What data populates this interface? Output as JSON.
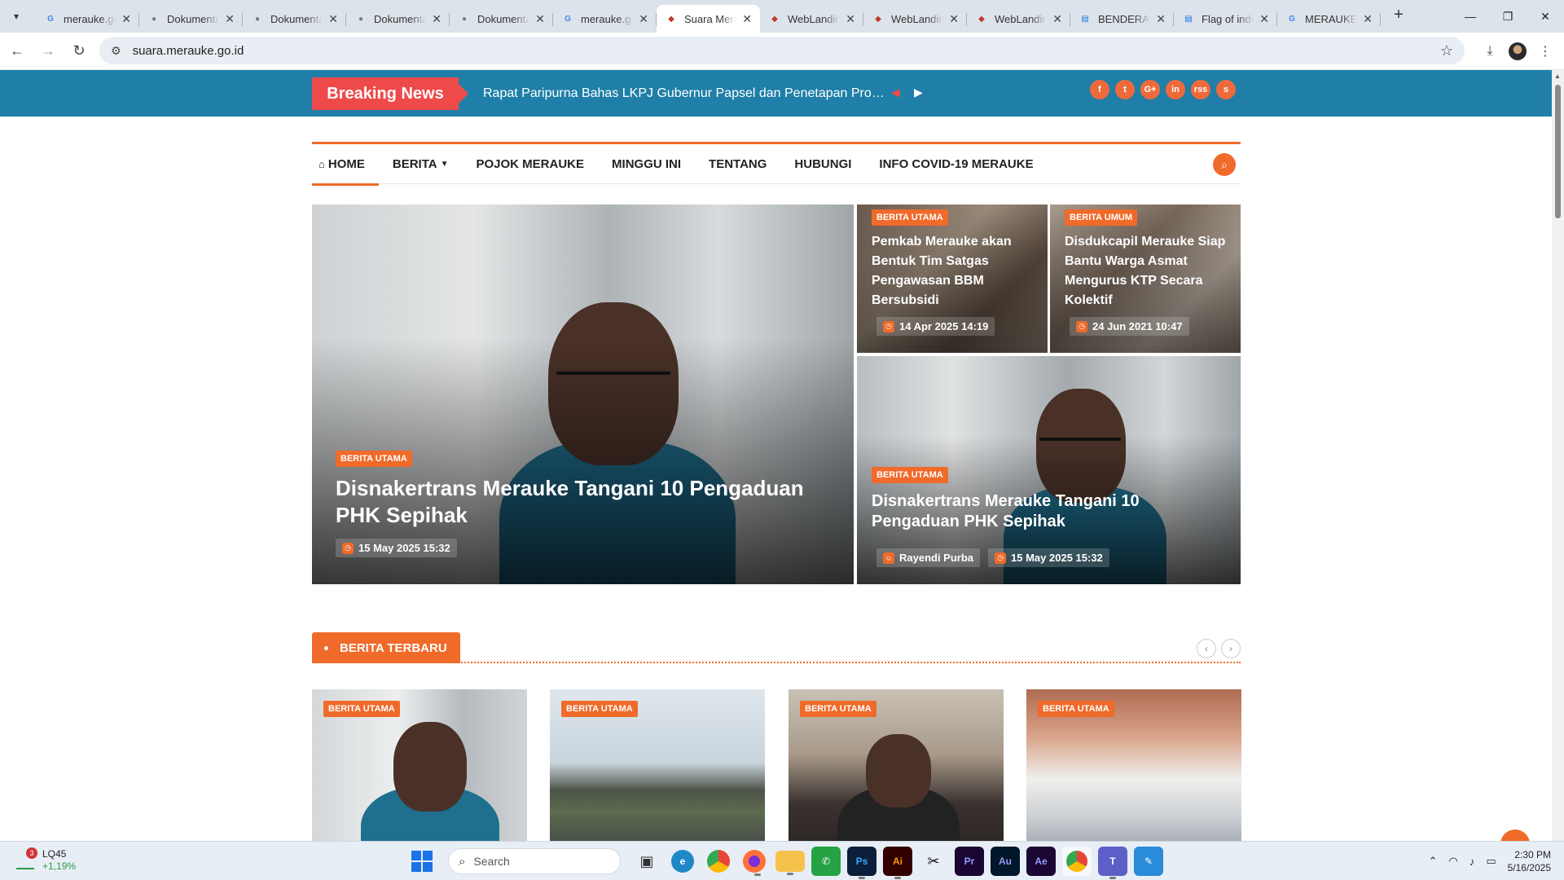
{
  "browser": {
    "tabs": [
      {
        "label": "merauke.go.id",
        "favicon": "G",
        "favicon_color": "#4285f4"
      },
      {
        "label": "Dokumentasi",
        "favicon": "●",
        "favicon_color": "#7a7a7a"
      },
      {
        "label": "Dokumentasi",
        "favicon": "●",
        "favicon_color": "#7a7a7a"
      },
      {
        "label": "Dokumentasi",
        "favicon": "●",
        "favicon_color": "#7a7a7a"
      },
      {
        "label": "Dokumentasi",
        "favicon": "●",
        "favicon_color": "#7a7a7a"
      },
      {
        "label": "merauke.go.id",
        "favicon": "G",
        "favicon_color": "#4285f4"
      },
      {
        "label": "Suara Merauke",
        "favicon": "◆",
        "favicon_color": "#c0392b",
        "active": true
      },
      {
        "label": "WebLanding",
        "favicon": "◆",
        "favicon_color": "#c0392b"
      },
      {
        "label": "WebLanding",
        "favicon": "◆",
        "favicon_color": "#c0392b"
      },
      {
        "label": "WebLanding",
        "favicon": "◆",
        "favicon_color": "#c0392b"
      },
      {
        "label": "BENDERA",
        "favicon": "▤",
        "favicon_color": "#1a73e8"
      },
      {
        "label": "Flag of indonesia",
        "favicon": "▤",
        "favicon_color": "#1a73e8"
      },
      {
        "label": "MERAUKE",
        "favicon": "G",
        "favicon_color": "#4285f4"
      }
    ],
    "url": "suara.merauke.go.id"
  },
  "site": {
    "breaking_label": "Breaking News",
    "breaking_text": "Rapat Paripurna Bahas LKPJ Gubernur Papsel dan Penetapan Propemperda",
    "socials": [
      "f",
      "t",
      "G+",
      "in",
      "rss",
      "s"
    ],
    "nav": [
      "HOME",
      "BERITA",
      "POJOK MERAUKE",
      "MINGGU INI",
      "TENTANG",
      "HUBUNGI",
      "INFO COVID-19 MERAUKE"
    ],
    "accent_color": "#f06a2a",
    "topbar_color": "#1f7fa8"
  },
  "hero": {
    "main": {
      "category": "BERITA UTAMA",
      "title": "Disnakertrans Merauke Tangani 10 Pengaduan PHK Sepihak",
      "date": "15 May 2025 15:32"
    },
    "side1": {
      "category": "BERITA UTAMA",
      "title": "Pemkab Merauke akan Bentuk Tim Satgas Pengawasan BBM Bersubsidi",
      "date": "14 Apr 2025 14:19"
    },
    "side2": {
      "category": "BERITA UMUM",
      "title": "Disdukcapil Merauke Siap Bantu Warga Asmat Mengurus KTP Secara Kolektif",
      "date": "24 Jun 2021 10:47"
    },
    "side3": {
      "category": "BERITA UTAMA",
      "title": "Disnakertrans Merauke Tangani 10 Pengaduan PHK Sepihak",
      "author": "Rayendi Purba",
      "date": "15 May 2025 15:32"
    }
  },
  "latest": {
    "heading": "BERITA TERBARU",
    "cards": [
      {
        "category": "BERITA UTAMA"
      },
      {
        "category": "BERITA UTAMA"
      },
      {
        "category": "BERITA UTAMA"
      },
      {
        "category": "BERITA UTAMA"
      }
    ]
  },
  "taskbar": {
    "widget_name": "LQ45",
    "widget_change": "+1,19%",
    "widget_badge": "3",
    "search_placeholder": "Search",
    "time": "2:30 PM",
    "date": "5/16/2025"
  }
}
